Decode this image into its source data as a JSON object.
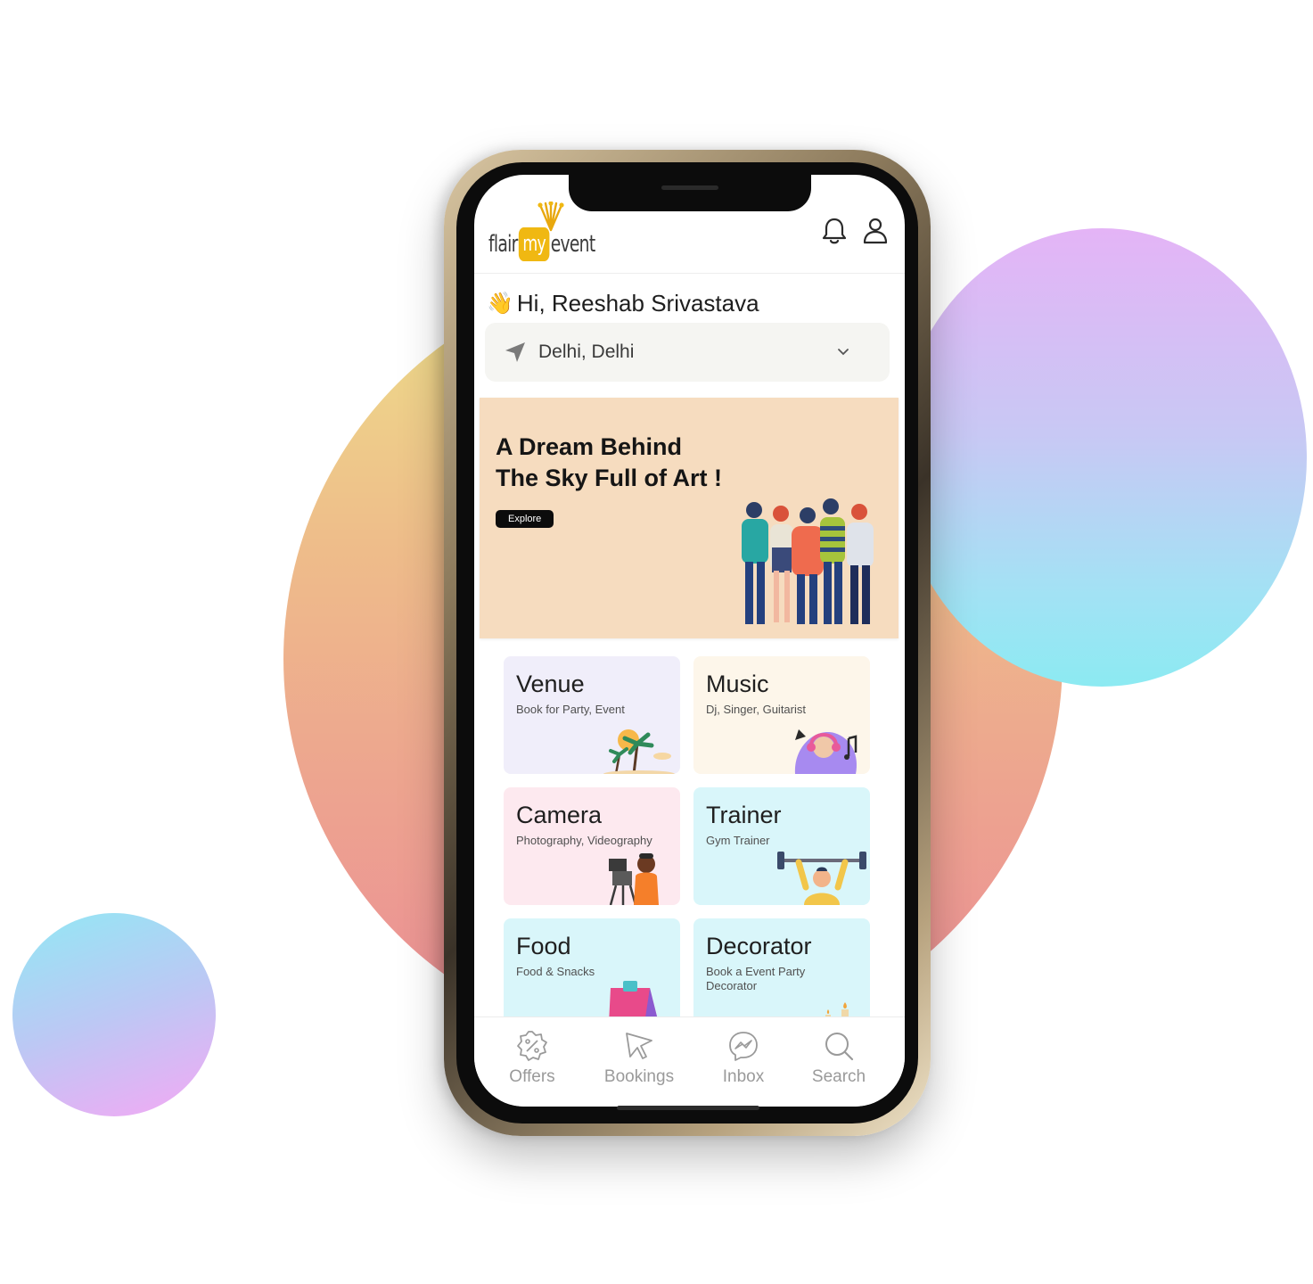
{
  "header": {
    "brand": {
      "part1": "flair",
      "part2": "my",
      "part3": "event"
    }
  },
  "greeting": {
    "wave": "👋",
    "text": "Hi, Reeshab Srivastava"
  },
  "location": {
    "value": "Delhi, Delhi"
  },
  "banner": {
    "title": "A Dream Behind\nThe Sky Full of Art !",
    "button": "Explore"
  },
  "categories": [
    {
      "title": "Venue",
      "subtitle": "Book for Party, Event",
      "color": "#f0eefa"
    },
    {
      "title": "Music",
      "subtitle": "Dj, Singer, Guitarist",
      "color": "#fdf6ea"
    },
    {
      "title": "Camera",
      "subtitle": "Photography, Videography",
      "color": "#fde9ef"
    },
    {
      "title": "Trainer",
      "subtitle": "Gym Trainer",
      "color": "#d9f6fa"
    },
    {
      "title": "Food",
      "subtitle": "Food & Snacks",
      "color": "#d9f6fa"
    },
    {
      "title": "Decorator",
      "subtitle": "Book a Event Party Decorator",
      "color": "#d9f6fa"
    }
  ],
  "bottom_nav": [
    {
      "label": "Offers",
      "icon": "offers-badge-icon"
    },
    {
      "label": "Bookings",
      "icon": "cursor-arrow-icon"
    },
    {
      "label": "Inbox",
      "icon": "messenger-icon"
    },
    {
      "label": "Search",
      "icon": "search-icon"
    }
  ],
  "colors": {
    "accent": "#f0b812",
    "banner_bg": "#f6dcbf",
    "nav_label": "#9a9a9a"
  }
}
